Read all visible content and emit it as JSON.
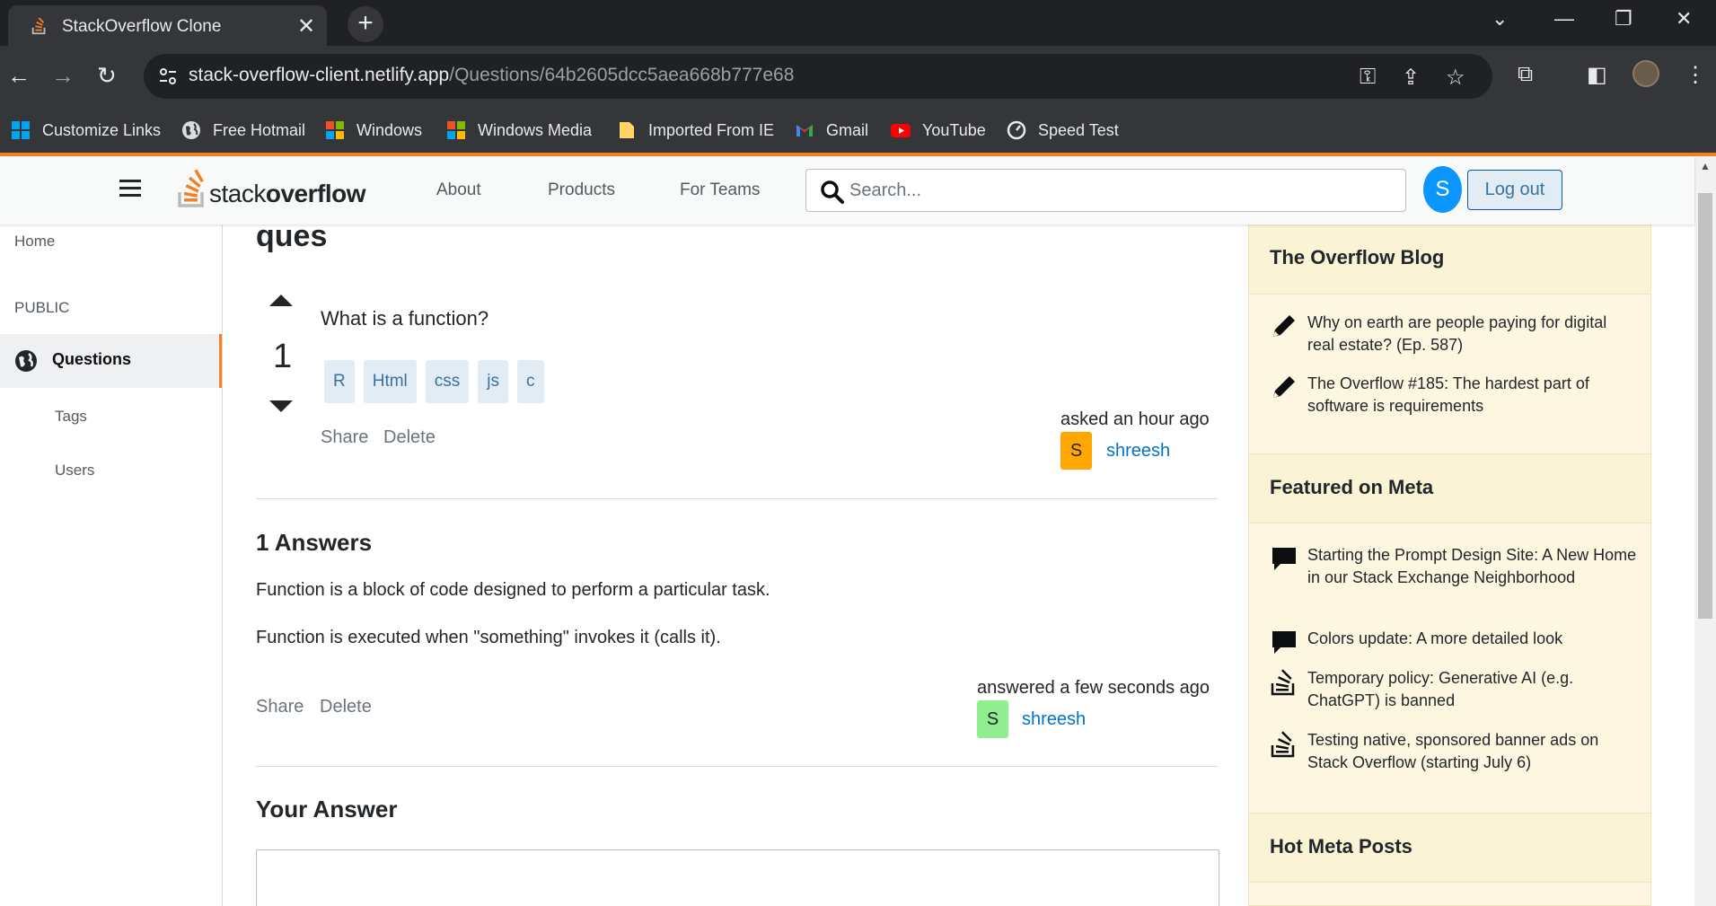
{
  "browser": {
    "tab_title": "StackOverflow Clone",
    "close_tab": "✕",
    "new_tab": "+",
    "url_domain": "stack-overflow-client.netlify.app",
    "url_path": "/Questions/64b2605dcc5aea668b777e68",
    "bookmarks": [
      {
        "label": "Customize Links",
        "icon": "windows-icon"
      },
      {
        "label": "Free Hotmail",
        "icon": "globe-icon"
      },
      {
        "label": "Windows",
        "icon": "windows-icon"
      },
      {
        "label": "Windows Media",
        "icon": "windows-icon"
      },
      {
        "label": "Imported From IE",
        "icon": "folder-icon"
      },
      {
        "label": "Gmail",
        "icon": "gmail-icon"
      },
      {
        "label": "YouTube",
        "icon": "youtube-icon"
      },
      {
        "label": "Speed Test",
        "icon": "speedometer-icon"
      }
    ]
  },
  "header": {
    "logo_light": "stack",
    "logo_bold": "overflow",
    "nav": {
      "about": "About",
      "products": "Products",
      "for_teams": "For Teams"
    },
    "search_placeholder": "Search...",
    "avatar_letter": "S",
    "logout_label": "Log out"
  },
  "sidebar": {
    "home": "Home",
    "public": "PUBLIC",
    "questions": "Questions",
    "tags": "Tags",
    "users": "Users"
  },
  "question": {
    "title": "ques",
    "votes": "1",
    "body": "What is a function?",
    "tags": [
      "R",
      "Html",
      "css",
      "js",
      "c"
    ],
    "share": "Share",
    "delete": "Delete",
    "asked": "asked an hour ago",
    "user_initial": "S",
    "user_name": "shreesh"
  },
  "answers": {
    "heading": "1 Answers",
    "items": [
      {
        "line1": "Function is a block of code designed to perform a particular task.",
        "line2": "Function is executed when \"something\" invokes it (calls it).",
        "share": "Share",
        "delete": "Delete",
        "answered": "answered a few seconds ago",
        "user_initial": "S",
        "user_name": "shreesh"
      }
    ]
  },
  "your_answer": {
    "heading": "Your Answer"
  },
  "right_sidebar": {
    "blog_title": "The Overflow Blog",
    "blog_items": [
      "Why on earth are people paying for digital real estate? (Ep. 587)",
      "The Overflow #185: The hardest part of software is requirements"
    ],
    "meta_title": "Featured on Meta",
    "meta_items": [
      {
        "text": "Starting the Prompt Design Site: A New Home in our Stack Exchange Neighborhood",
        "icon": "comment-icon"
      },
      {
        "text": "Colors update: A more detailed look",
        "icon": "comment-icon"
      },
      {
        "text": "Temporary policy: Generative AI (e.g. ChatGPT) is banned",
        "icon": "stack-icon"
      },
      {
        "text": "Testing native, sponsored banner ads on Stack Overflow (starting July 6)",
        "icon": "stack-icon"
      }
    ],
    "hot_title": "Hot Meta Posts"
  },
  "colors": {
    "accent": "#f48024",
    "link": "#0074cc",
    "tag_bg": "#e1ecf4",
    "sidebar_bg": "#fdf7e2",
    "avatar_blue": "#0a95ff",
    "asker_avatar": "#ffa600",
    "answerer_avatar": "#90ee90"
  }
}
